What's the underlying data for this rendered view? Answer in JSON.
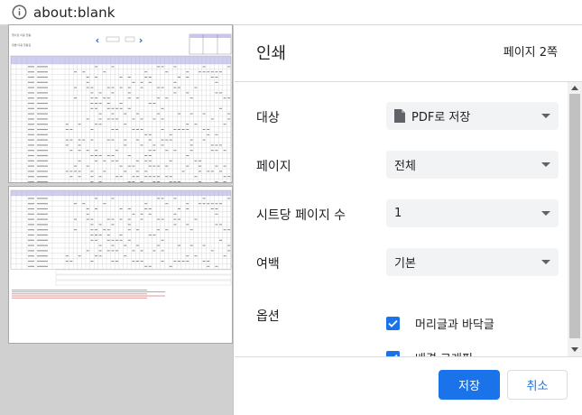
{
  "addressbar": {
    "url": "about:blank",
    "icon": "info-icon"
  },
  "preview": {
    "pages": [
      {
        "title": "행사장 이용 현황",
        "subtitle": "월별 이용 현황표"
      },
      {
        "title": "",
        "subtitle": ""
      }
    ]
  },
  "panel": {
    "title": "인쇄",
    "page_count": "페이지 2쪽"
  },
  "settings": {
    "destination": {
      "label": "대상",
      "value": "PDF로 저장",
      "icon": "document-icon"
    },
    "pages": {
      "label": "페이지",
      "value": "전체"
    },
    "pages_per_sheet": {
      "label": "시트당 페이지 수",
      "value": "1"
    },
    "margins": {
      "label": "여백",
      "value": "기본"
    },
    "options": {
      "label": "옵션",
      "headers_footers": {
        "label": "머리글과 바닥글",
        "checked": true
      },
      "background_graphics": {
        "label": "배경 그래픽",
        "checked": true
      }
    }
  },
  "buttons": {
    "save": "저장",
    "cancel": "취소"
  },
  "colors": {
    "accent": "#1a73e8",
    "select_bg": "#f1f3f4",
    "preview_bg": "#d0d0d0"
  }
}
